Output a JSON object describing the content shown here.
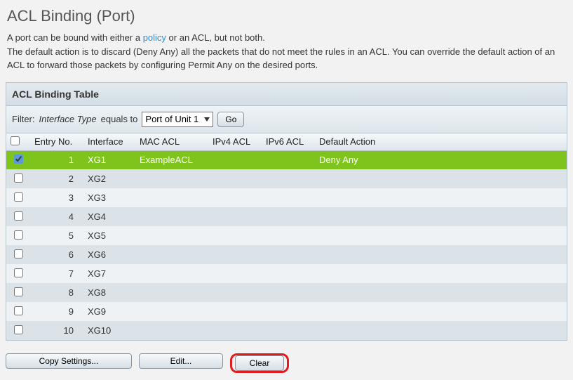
{
  "page": {
    "title": "ACL Binding (Port)",
    "desc_prefix": "A port can be bound with either a ",
    "desc_link": "policy",
    "desc_mid": " or an ACL, but not both.",
    "desc2": "The default action is to discard (Deny Any) all the packets that do not meet the rules in an ACL. You can override the default action of an ACL to forward those packets by configuring Permit Any on the desired ports."
  },
  "panel": {
    "title": "ACL Binding Table"
  },
  "filter": {
    "label": "Filter:",
    "field": "Interface Type",
    "equals": "equals to",
    "value": "Port of Unit 1",
    "go": "Go"
  },
  "columns": {
    "entry": "Entry No.",
    "iface": "Interface",
    "mac": "MAC ACL",
    "v4": "IPv4 ACL",
    "v6": "IPv6 ACL",
    "act": "Default Action"
  },
  "rows": [
    {
      "checked": true,
      "no": "1",
      "iface": "XG1",
      "mac": "ExampleACL",
      "v4": "",
      "v6": "",
      "act": "Deny Any",
      "selected": true
    },
    {
      "checked": false,
      "no": "2",
      "iface": "XG2",
      "mac": "",
      "v4": "",
      "v6": "",
      "act": "",
      "selected": false
    },
    {
      "checked": false,
      "no": "3",
      "iface": "XG3",
      "mac": "",
      "v4": "",
      "v6": "",
      "act": "",
      "selected": false
    },
    {
      "checked": false,
      "no": "4",
      "iface": "XG4",
      "mac": "",
      "v4": "",
      "v6": "",
      "act": "",
      "selected": false
    },
    {
      "checked": false,
      "no": "5",
      "iface": "XG5",
      "mac": "",
      "v4": "",
      "v6": "",
      "act": "",
      "selected": false
    },
    {
      "checked": false,
      "no": "6",
      "iface": "XG6",
      "mac": "",
      "v4": "",
      "v6": "",
      "act": "",
      "selected": false
    },
    {
      "checked": false,
      "no": "7",
      "iface": "XG7",
      "mac": "",
      "v4": "",
      "v6": "",
      "act": "",
      "selected": false
    },
    {
      "checked": false,
      "no": "8",
      "iface": "XG8",
      "mac": "",
      "v4": "",
      "v6": "",
      "act": "",
      "selected": false
    },
    {
      "checked": false,
      "no": "9",
      "iface": "XG9",
      "mac": "",
      "v4": "",
      "v6": "",
      "act": "",
      "selected": false
    },
    {
      "checked": false,
      "no": "10",
      "iface": "XG10",
      "mac": "",
      "v4": "",
      "v6": "",
      "act": "",
      "selected": false
    }
  ],
  "buttons": {
    "copy": "Copy Settings...",
    "edit": "Edit...",
    "clear": "Clear"
  }
}
